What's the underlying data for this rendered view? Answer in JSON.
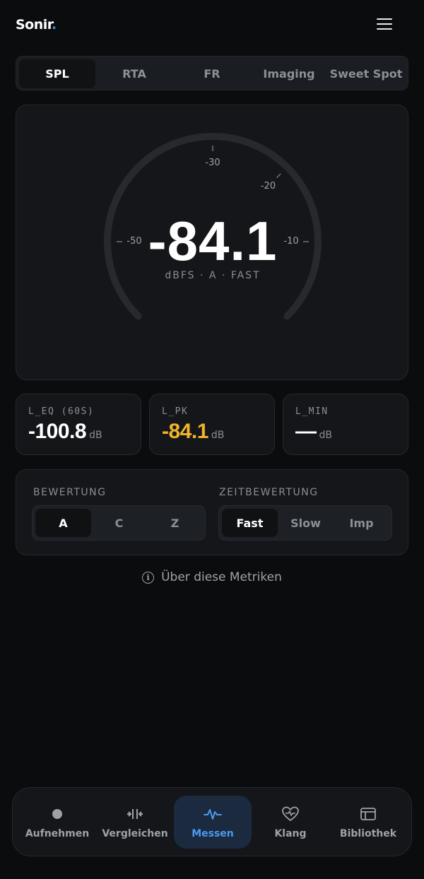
{
  "header": {
    "logo_text": "Sonir",
    "logo_dot": "."
  },
  "tabs": [
    {
      "label": "SPL",
      "active": true
    },
    {
      "label": "RTA",
      "active": false
    },
    {
      "label": "FR",
      "active": false
    },
    {
      "label": "Imaging",
      "active": false
    },
    {
      "label": "Sweet Spot",
      "active": false
    }
  ],
  "gauge": {
    "value": "-84.1",
    "unit_line": "dBFS · A · FAST",
    "scale_min": -60,
    "scale_max": 0,
    "ticks": [
      "-50",
      "-30",
      "-20",
      "-10"
    ]
  },
  "metrics": [
    {
      "label": "L_EQ (60S)",
      "value": "-100.8",
      "unit": "dB"
    },
    {
      "label": "L_PK",
      "value": "-84.1",
      "unit": "dB"
    },
    {
      "label": "L_MIN",
      "value": "—",
      "unit": "dB"
    }
  ],
  "settings": {
    "weighting_label": "BEWERTUNG",
    "weighting_options": [
      "A",
      "C",
      "Z"
    ],
    "weighting_selected": "A",
    "time_label": "ZEITBEWERTUNG",
    "time_options": [
      "Fast",
      "Slow",
      "Imp"
    ],
    "time_selected": "Fast"
  },
  "info_link": "Über diese Metriken",
  "nav": [
    {
      "label": "Aufnehmen",
      "icon": "record-dot-icon",
      "active": false
    },
    {
      "label": "Vergleichen",
      "icon": "compare-icon",
      "active": false
    },
    {
      "label": "Messen",
      "icon": "waveform-icon",
      "active": true
    },
    {
      "label": "Klang",
      "icon": "heart-pulse-icon",
      "active": false
    },
    {
      "label": "Bibliothek",
      "icon": "library-icon",
      "active": false
    }
  ],
  "colors": {
    "accent": "#3b8fe8",
    "peak": "#f0b429",
    "background": "#0b0c0e",
    "card": "#141619"
  }
}
